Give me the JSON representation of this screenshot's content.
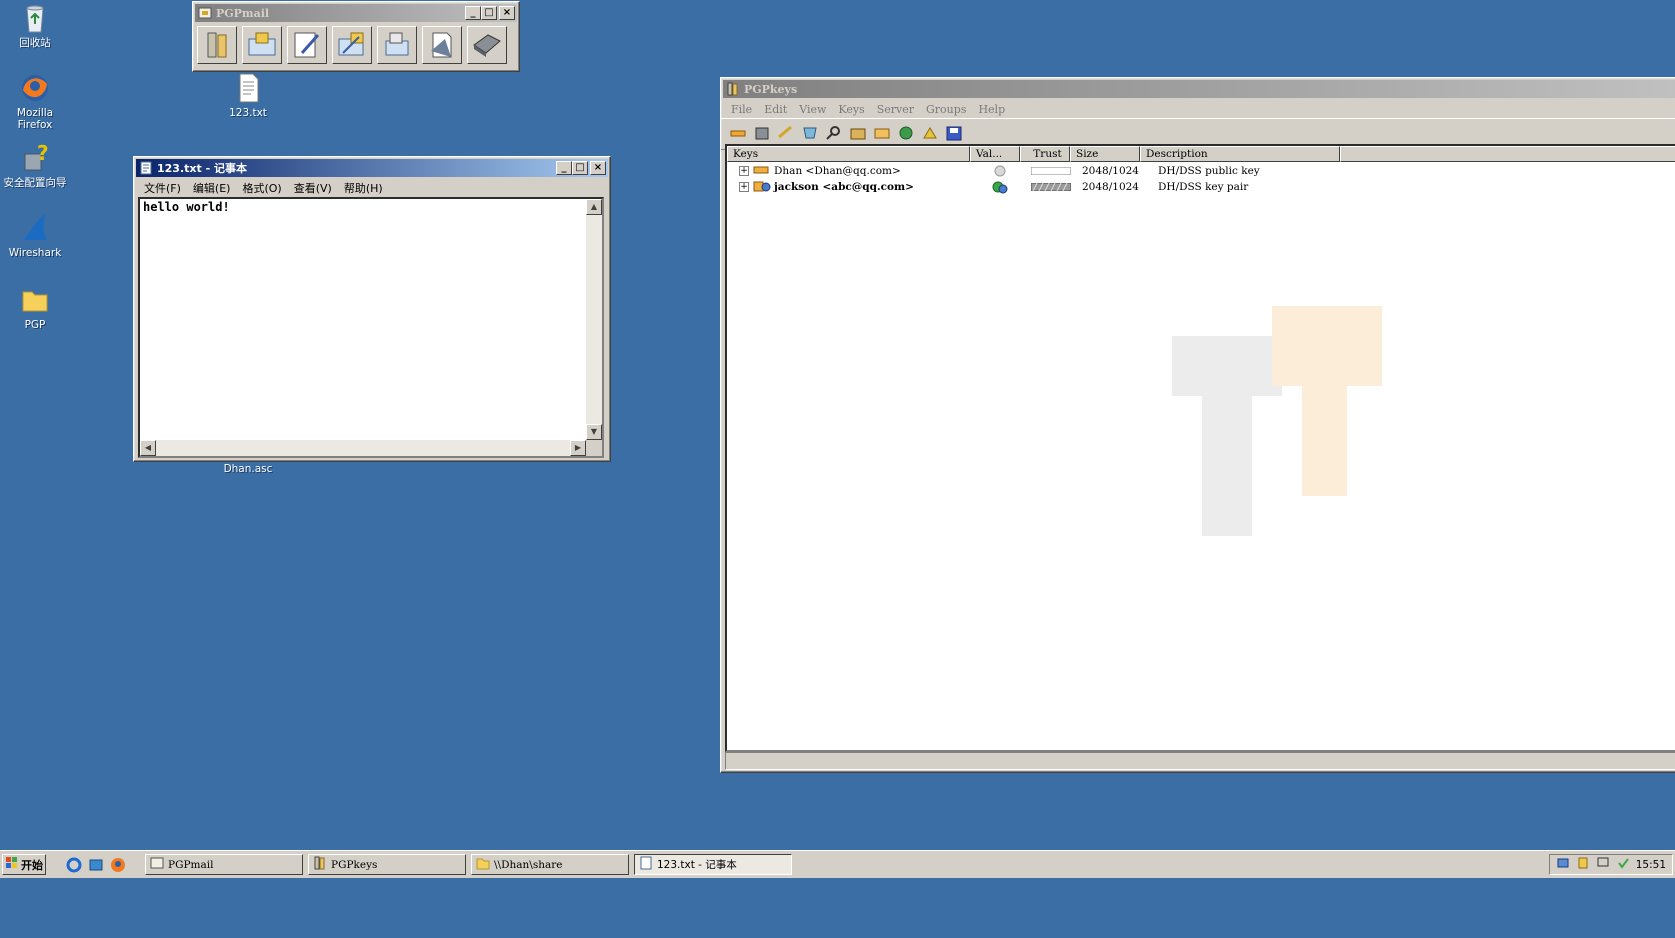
{
  "desktop": {
    "icons": [
      {
        "label": "回收站"
      },
      {
        "label": "Mozilla\nFirefox"
      },
      {
        "label": "安全配置向导"
      },
      {
        "label": "Wireshark"
      },
      {
        "label": "PGP"
      },
      {
        "label": "123.txt"
      },
      {
        "label": "Dhan.asc"
      }
    ]
  },
  "pgpmail": {
    "title": "PGPmail",
    "buttons": [
      "pgpkeys-icon",
      "encrypt-icon",
      "sign-icon",
      "encrypt-sign-icon",
      "decrypt-verify-icon",
      "wipe-icon",
      "freespace-wipe-icon"
    ]
  },
  "notepad": {
    "title": "123.txt - 记事本",
    "menu": [
      "文件(F)",
      "编辑(E)",
      "格式(O)",
      "查看(V)",
      "帮助(H)"
    ],
    "content": "hello world!"
  },
  "pgpkeys": {
    "title": "PGPkeys",
    "menu": [
      "File",
      "Edit",
      "View",
      "Keys",
      "Server",
      "Groups",
      "Help"
    ],
    "columns": [
      "Keys",
      "Val...",
      "Trust",
      "Size",
      "Description"
    ],
    "rows": [
      {
        "name": "Dhan <Dhan@qq.com>",
        "validity": "grey",
        "trust": 0,
        "size": "2048/1024",
        "description": "DH/DSS public key",
        "bold": false
      },
      {
        "name": "jackson <abc@qq.com>",
        "validity": "green",
        "trust": 1,
        "size": "2048/1024",
        "description": "DH/DSS key pair",
        "bold": true
      }
    ]
  },
  "taskbar": {
    "start": "开始",
    "tasks": [
      "PGPmail",
      "PGPkeys",
      "\\\\Dhan\\share",
      "123.txt - 记事本"
    ],
    "clock": "15:51"
  },
  "colors": {
    "desktop": "#3a6ea5",
    "titlebar_active": "#0a246a",
    "titlebar_inactive": "#808080"
  }
}
